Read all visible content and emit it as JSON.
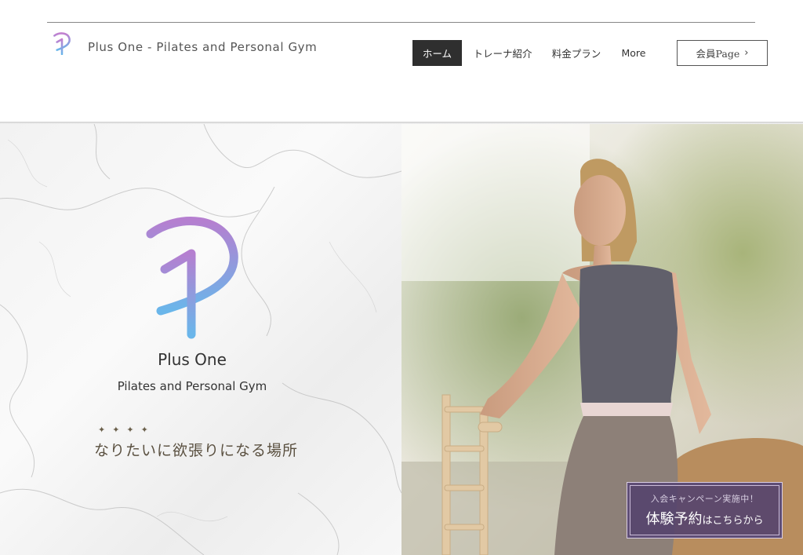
{
  "header": {
    "site_title": "Plus One - Pilates and Personal Gym",
    "nav": [
      "ホーム",
      "トレーナ紹介",
      "料金プラン",
      "More"
    ],
    "member_button": "会員Page",
    "member_arrow": "›"
  },
  "hero": {
    "brand_name": "Plus One",
    "brand_sub": "Pilates and Personal Gym",
    "stars": "✦✦✦✦",
    "catchphrase": "なりたいに欲張りになる場所"
  },
  "campaign": {
    "line1": "入会キャンペーン実施中！",
    "line2_big": "体験予約",
    "line2_small": "はこちらから"
  },
  "colors": {
    "accent_dark": "#2f2f2f",
    "campaign_bg": "#56446e",
    "logo_gradient_top": "#b57fd0",
    "logo_gradient_bottom": "#6ab6ea"
  }
}
